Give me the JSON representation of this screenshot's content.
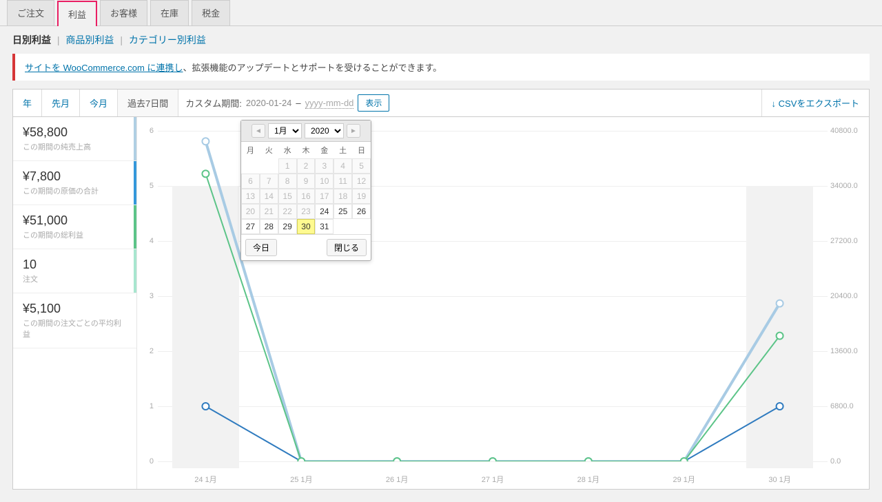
{
  "top_tabs": {
    "items": [
      {
        "label": "ご注文",
        "active": false
      },
      {
        "label": "利益",
        "active": true
      },
      {
        "label": "お客様",
        "active": false
      },
      {
        "label": "在庫",
        "active": false
      },
      {
        "label": "税金",
        "active": false
      }
    ]
  },
  "sub_links": {
    "current": "日別利益",
    "items": [
      "商品別利益",
      "カテゴリー別利益"
    ]
  },
  "notice": {
    "link_text": "サイトを WooCommerce.com に連携し",
    "after": "、拡張機能のアップデートとサポートを受けることができます。"
  },
  "range_tabs": [
    {
      "label": "年",
      "active": false
    },
    {
      "label": "先月",
      "active": false
    },
    {
      "label": "今月",
      "active": false
    },
    {
      "label": "過去7日間",
      "active": true
    }
  ],
  "custom_period": {
    "label": "カスタム期間:",
    "from": "2020-01-24",
    "dash": "–",
    "placeholder": "yyyy-mm-dd",
    "show": "表示"
  },
  "export": {
    "arrow": "↓",
    "label": "CSVをエクスポート"
  },
  "metrics": [
    {
      "value": "¥58,800",
      "label": "この期間の純売上高",
      "color": "c-lightblue"
    },
    {
      "value": "¥7,800",
      "label": "この期間の原価の合計",
      "color": "c-blue"
    },
    {
      "value": "¥51,000",
      "label": "この期間の総利益",
      "color": "c-green"
    },
    {
      "value": "10",
      "label": "注文",
      "color": "c-teal"
    },
    {
      "value": "¥5,100",
      "label": "この期間の注文ごとの平均利益",
      "color": ""
    }
  ],
  "chart_data": {
    "type": "line",
    "categories": [
      "24 1月",
      "25 1月",
      "26 1月",
      "27 1月",
      "28 1月",
      "29 1月",
      "30 1月"
    ],
    "left_axis": {
      "min": 0,
      "max": 6,
      "ticks": [
        0,
        1,
        2,
        3,
        4,
        5,
        6
      ]
    },
    "right_axis": {
      "min": 0,
      "max": 40800,
      "ticks": [
        0,
        6800,
        13600,
        20400,
        27200,
        34000,
        40800
      ]
    },
    "series": [
      {
        "name": "orders",
        "axis": "left",
        "color": "#2f7bbf",
        "values": [
          1.0,
          0,
          0,
          0,
          0,
          0,
          1.0
        ]
      },
      {
        "name": "net_sales",
        "axis": "right",
        "color": "#a8cbe4",
        "values": [
          39500,
          0,
          0,
          0,
          0,
          0,
          19500
        ]
      },
      {
        "name": "profit",
        "axis": "right",
        "color": "#5cc488",
        "values": [
          35500,
          0,
          0,
          0,
          0,
          0,
          15500
        ]
      }
    ]
  },
  "datepicker": {
    "month_options": [
      "1月"
    ],
    "month_selected": "1月",
    "year_options": [
      "2020"
    ],
    "year_selected": "2020",
    "dow": [
      "月",
      "火",
      "水",
      "木",
      "金",
      "土",
      "日"
    ],
    "weeks": [
      [
        null,
        null,
        1,
        2,
        3,
        4,
        5
      ],
      [
        6,
        7,
        8,
        9,
        10,
        11,
        12
      ],
      [
        13,
        14,
        15,
        16,
        17,
        18,
        19
      ],
      [
        20,
        21,
        22,
        23,
        24,
        25,
        26
      ],
      [
        27,
        28,
        29,
        30,
        31,
        null,
        null
      ]
    ],
    "disabled_through": 23,
    "selected": 30,
    "today_btn": "今日",
    "close_btn": "閉じる"
  }
}
